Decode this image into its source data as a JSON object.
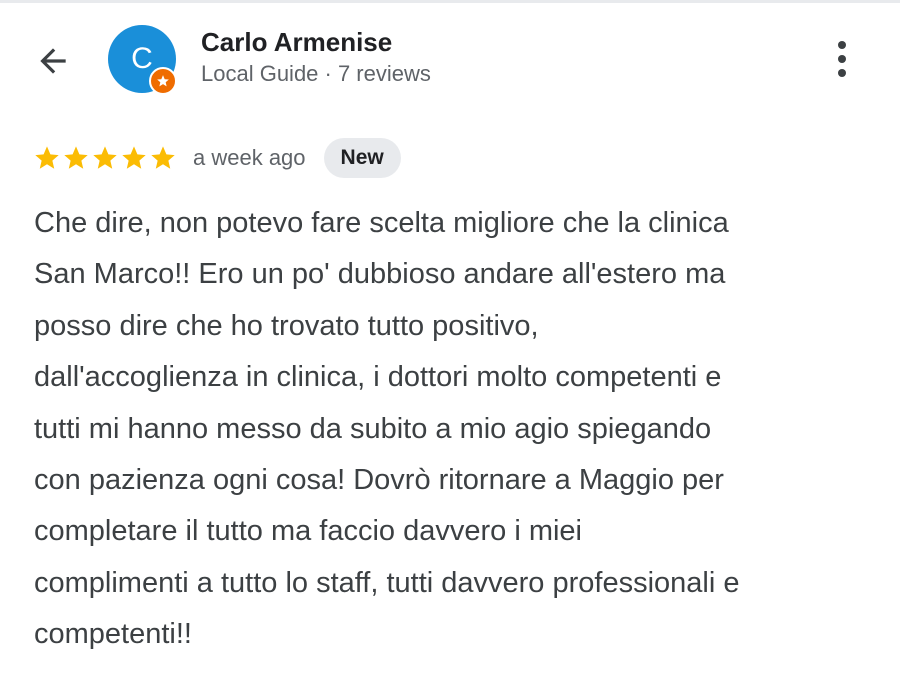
{
  "header": {
    "back_icon": "arrow-left-icon",
    "avatar_initial": "C",
    "avatar_color": "#1a8fd9",
    "badge_color": "#ef6c00",
    "reviewer_name": "Carlo Armenise",
    "subtitle": "Local Guide · 7 reviews",
    "more_icon": "more-vertical-icon"
  },
  "review": {
    "rating": 5,
    "max_rating": 5,
    "star_color": "#fbbc04",
    "time": "a week ago",
    "badge": "New",
    "text": "Che dire, non potevo fare scelta migliore che la clinica\nSan Marco!! Ero un po' dubbioso andare all'estero ma\nposso dire che ho trovato tutto positivo,\ndall'accoglienza in clinica, i dottori molto competenti e\ntutti mi hanno messo da subito a mio agio spiegando\ncon pazienza ogni cosa! Dovrò ritornare a Maggio per\ncompletare il tutto ma faccio davvero i miei\ncomplimenti a tutto lo staff, tutti davvero professionali e\ncompetenti!!"
  }
}
